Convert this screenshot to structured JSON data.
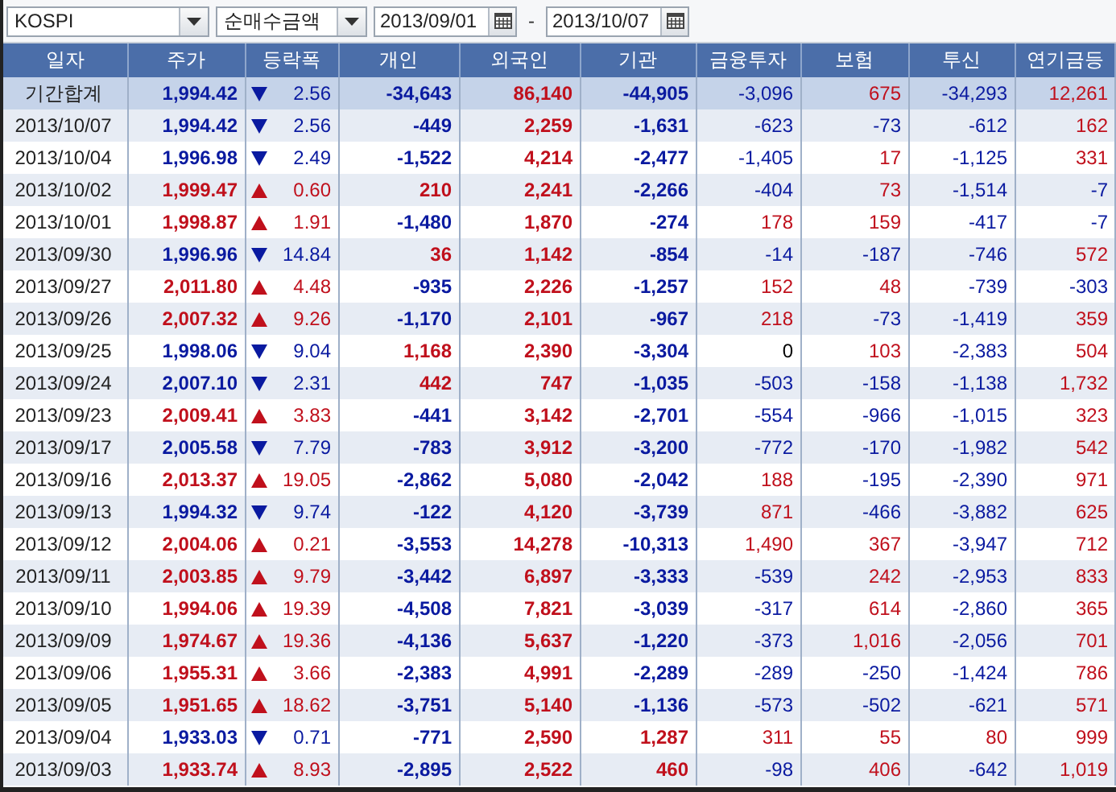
{
  "toolbar": {
    "market_select": {
      "value": "KOSPI"
    },
    "type_select": {
      "value": "순매수금액"
    },
    "start_date": {
      "value": "2013/09/01"
    },
    "separator": "-",
    "end_date": {
      "value": "2013/10/07"
    }
  },
  "table": {
    "columns": [
      "일자",
      "주가",
      "등락폭",
      "개인",
      "외국인",
      "기관",
      "금융투자",
      "보험",
      "투신",
      "연기금등"
    ],
    "rows": [
      {
        "kind": "total",
        "date": "기간합계",
        "price": "1,994.42",
        "up": false,
        "change": "2.56",
        "values": [
          "-34,643",
          "86,140",
          "-44,905",
          "-3,096",
          "675",
          "-34,293",
          "12,261"
        ]
      },
      {
        "kind": "day",
        "date": "2013/10/07",
        "price": "1,994.42",
        "up": false,
        "change": "2.56",
        "values": [
          "-449",
          "2,259",
          "-1,631",
          "-623",
          "-73",
          "-612",
          "162"
        ]
      },
      {
        "kind": "day",
        "date": "2013/10/04",
        "price": "1,996.98",
        "up": false,
        "change": "2.49",
        "values": [
          "-1,522",
          "4,214",
          "-2,477",
          "-1,405",
          "17",
          "-1,125",
          "331"
        ]
      },
      {
        "kind": "day",
        "date": "2013/10/02",
        "price": "1,999.47",
        "up": true,
        "change": "0.60",
        "values": [
          "210",
          "2,241",
          "-2,266",
          "-404",
          "73",
          "-1,514",
          "-7"
        ]
      },
      {
        "kind": "day",
        "date": "2013/10/01",
        "price": "1,998.87",
        "up": true,
        "change": "1.91",
        "values": [
          "-1,480",
          "1,870",
          "-274",
          "178",
          "159",
          "-417",
          "-7"
        ]
      },
      {
        "kind": "day",
        "date": "2013/09/30",
        "price": "1,996.96",
        "up": false,
        "change": "14.84",
        "values": [
          "36",
          "1,142",
          "-854",
          "-14",
          "-187",
          "-746",
          "572"
        ]
      },
      {
        "kind": "day",
        "date": "2013/09/27",
        "price": "2,011.80",
        "up": true,
        "change": "4.48",
        "values": [
          "-935",
          "2,226",
          "-1,257",
          "152",
          "48",
          "-739",
          "-303"
        ]
      },
      {
        "kind": "day",
        "date": "2013/09/26",
        "price": "2,007.32",
        "up": true,
        "change": "9.26",
        "values": [
          "-1,170",
          "2,101",
          "-967",
          "218",
          "-73",
          "-1,419",
          "359"
        ]
      },
      {
        "kind": "day",
        "date": "2013/09/25",
        "price": "1,998.06",
        "up": false,
        "change": "9.04",
        "values": [
          "1,168",
          "2,390",
          "-3,304",
          "0",
          "103",
          "-2,383",
          "504"
        ]
      },
      {
        "kind": "day",
        "date": "2013/09/24",
        "price": "2,007.10",
        "up": false,
        "change": "2.31",
        "values": [
          "442",
          "747",
          "-1,035",
          "-503",
          "-158",
          "-1,138",
          "1,732"
        ]
      },
      {
        "kind": "day",
        "date": "2013/09/23",
        "price": "2,009.41",
        "up": true,
        "change": "3.83",
        "values": [
          "-441",
          "3,142",
          "-2,701",
          "-554",
          "-966",
          "-1,015",
          "323"
        ]
      },
      {
        "kind": "day",
        "date": "2013/09/17",
        "price": "2,005.58",
        "up": false,
        "change": "7.79",
        "values": [
          "-783",
          "3,912",
          "-3,200",
          "-772",
          "-170",
          "-1,982",
          "542"
        ]
      },
      {
        "kind": "day",
        "date": "2013/09/16",
        "price": "2,013.37",
        "up": true,
        "change": "19.05",
        "values": [
          "-2,862",
          "5,080",
          "-2,042",
          "188",
          "-195",
          "-2,390",
          "971"
        ]
      },
      {
        "kind": "day",
        "date": "2013/09/13",
        "price": "1,994.32",
        "up": false,
        "change": "9.74",
        "values": [
          "-122",
          "4,120",
          "-3,739",
          "871",
          "-466",
          "-3,882",
          "625"
        ]
      },
      {
        "kind": "day",
        "date": "2013/09/12",
        "price": "2,004.06",
        "up": true,
        "change": "0.21",
        "values": [
          "-3,553",
          "14,278",
          "-10,313",
          "1,490",
          "367",
          "-3,947",
          "712"
        ]
      },
      {
        "kind": "day",
        "date": "2013/09/11",
        "price": "2,003.85",
        "up": true,
        "change": "9.79",
        "values": [
          "-3,442",
          "6,897",
          "-3,333",
          "-539",
          "242",
          "-2,953",
          "833"
        ]
      },
      {
        "kind": "day",
        "date": "2013/09/10",
        "price": "1,994.06",
        "up": true,
        "change": "19.39",
        "values": [
          "-4,508",
          "7,821",
          "-3,039",
          "-317",
          "614",
          "-2,860",
          "365"
        ]
      },
      {
        "kind": "day",
        "date": "2013/09/09",
        "price": "1,974.67",
        "up": true,
        "change": "19.36",
        "values": [
          "-4,136",
          "5,637",
          "-1,220",
          "-373",
          "1,016",
          "-2,056",
          "701"
        ]
      },
      {
        "kind": "day",
        "date": "2013/09/06",
        "price": "1,955.31",
        "up": true,
        "change": "3.66",
        "values": [
          "-2,383",
          "4,991",
          "-2,289",
          "-289",
          "-250",
          "-1,424",
          "786"
        ]
      },
      {
        "kind": "day",
        "date": "2013/09/05",
        "price": "1,951.65",
        "up": true,
        "change": "18.62",
        "values": [
          "-3,751",
          "5,140",
          "-1,136",
          "-573",
          "-502",
          "-621",
          "571"
        ]
      },
      {
        "kind": "day",
        "date": "2013/09/04",
        "price": "1,933.03",
        "up": false,
        "change": "0.71",
        "values": [
          "-771",
          "2,590",
          "1,287",
          "311",
          "55",
          "80",
          "999"
        ]
      },
      {
        "kind": "day",
        "date": "2013/09/03",
        "price": "1,933.74",
        "up": true,
        "change": "8.93",
        "values": [
          "-2,895",
          "2,522",
          "460",
          "-98",
          "406",
          "-642",
          "1,019"
        ]
      }
    ]
  }
}
